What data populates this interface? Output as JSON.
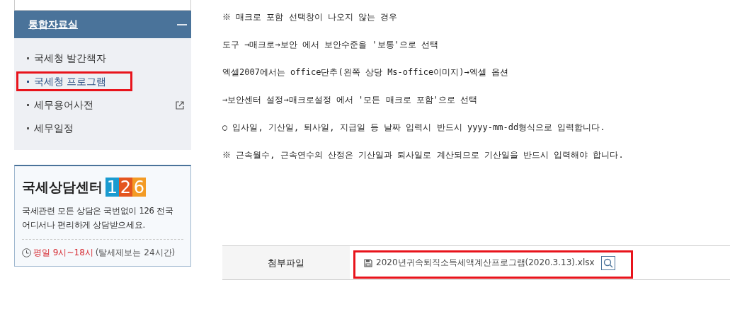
{
  "sidebar": {
    "section": {
      "title": "통합자료실",
      "expanded": true
    },
    "items": [
      {
        "label": "국세청 발간책자",
        "selected": false,
        "external": false,
        "highlighted": false
      },
      {
        "label": "국세청 프로그램",
        "selected": true,
        "external": false,
        "highlighted": true
      },
      {
        "label": "세무용어사전",
        "selected": false,
        "external": true,
        "highlighted": false
      },
      {
        "label": "세무일정",
        "selected": false,
        "external": false,
        "highlighted": false
      }
    ],
    "counsel": {
      "title": "국세상담센터",
      "number": [
        "1",
        "2",
        "6"
      ],
      "description": "국세관련 모든 상담은 국번없이 126 전국 어디서나 편리하게 상담받으세요.",
      "hours": "평일 9시~18시",
      "note": "(탈세제보는 24시간)"
    }
  },
  "content": {
    "lines": [
      "※ 매크로 포함 선택창이 나오지 않는 경우",
      "도구 →매크로→보안 에서 보안수준을 '보통'으로 선택",
      "엑셀2007에서는 office단추(왼쪽 상당 Ms-office이미지)→엑셀 옵션",
      "→보안센터 설정→매크로설정 에서 '모든 매크로 포함'으로 선택",
      "○ 입사일, 기산일, 퇴사일, 지급일 등 날짜 입력시 반드시 yyyy-mm-dd형식으로 입력합니다.",
      "※ 근속월수, 근속연수의 산정은 기산일과 퇴사일로 계산되므로 기산일을 반드시 입력해야 합니다."
    ],
    "attachment": {
      "label": "첨부파일",
      "file": "2020년귀속퇴직소득세액계산프로그램(2020.3.13).xlsx",
      "highlighted": true
    }
  }
}
